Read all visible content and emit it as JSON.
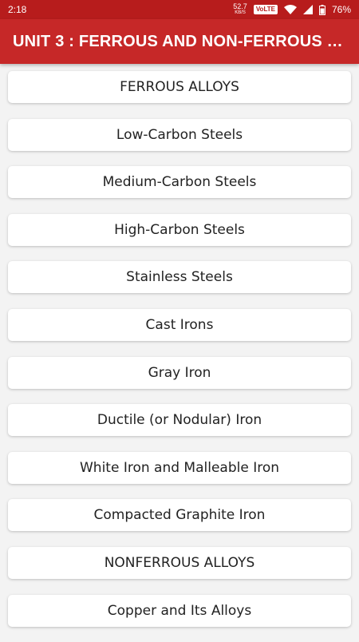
{
  "status_bar": {
    "time": "2:18",
    "net_speed": "52.7",
    "net_speed_unit": "KB/S",
    "volte": "VoLTE",
    "battery": "76%"
  },
  "app_bar": {
    "title": "UNIT 3 : FERROUS AND NON-FERROUS ME..."
  },
  "items": [
    {
      "label": "FERROUS ALLOYS"
    },
    {
      "label": "Low-Carbon Steels"
    },
    {
      "label": "Medium-Carbon Steels"
    },
    {
      "label": "High-Carbon Steels"
    },
    {
      "label": "Stainless Steels"
    },
    {
      "label": "Cast Irons"
    },
    {
      "label": "Gray Iron"
    },
    {
      "label": "Ductile (or Nodular) Iron"
    },
    {
      "label": "White Iron and Malleable Iron"
    },
    {
      "label": "Compacted Graphite Iron"
    },
    {
      "label": "NONFERROUS ALLOYS"
    },
    {
      "label": "Copper and Its Alloys"
    }
  ],
  "colors": {
    "status_bar": "#b71c1c",
    "app_bar": "#c62828",
    "background": "#f3f3f3"
  }
}
